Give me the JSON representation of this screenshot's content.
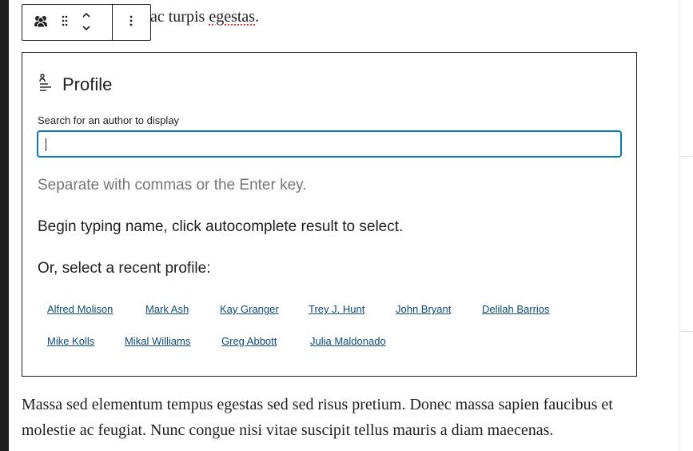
{
  "editor": {
    "paragraph_above_tail": "ac turpis egestas.",
    "spell_flagged_word": "egestas",
    "paragraph_below": "Massa sed elementum tempus egestas sed sed risus pretium. Donec massa sapien faucibus et molestie ac feugiat. Nunc congue nisi vitae suscipit tellus mauris a diam maecenas."
  },
  "toolbar": {
    "block_icon": "people-icon",
    "drag_icon": "drag-handle-icon",
    "move_up_icon": "chevron-up-icon",
    "move_down_icon": "chevron-down-icon",
    "more_icon": "more-vertical-icon"
  },
  "profile_block": {
    "title": "Profile",
    "title_icon": "profile-block-icon",
    "search_label": "Search for an author to display",
    "search_value": "",
    "help_text": "Separate with commas or the Enter key.",
    "instruction": "Begin typing name, click autocomplete result to select.",
    "recent_label": "Or, select a recent profile:",
    "recent_profiles": [
      "Alfred Molison",
      "Mark Ash",
      "Kay Granger",
      "Trey J. Hunt",
      "John Bryant",
      "Delilah Barrios",
      "Mike Kolls",
      "Mikal Williams",
      "Greg Abbott",
      "Julia Maldonado"
    ]
  },
  "colors": {
    "link": "#0a4b78",
    "focus": "#007cba",
    "text": "#1e1e1e",
    "muted": "#757575",
    "spellcheck": "#d63638"
  }
}
